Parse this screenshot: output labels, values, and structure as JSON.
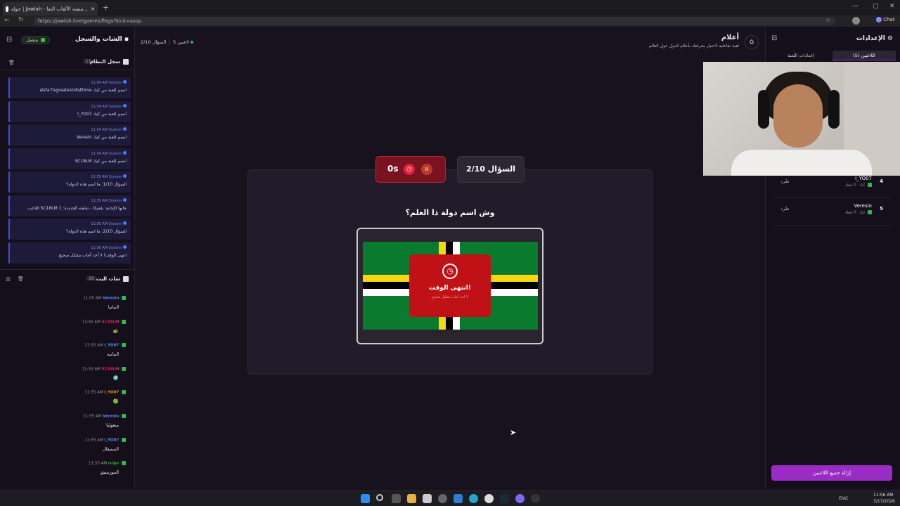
{
  "browser": {
    "tab_title": "جولة | Jawlah - منصة الألعاب التفا...",
    "url": "https://jawlah.live/games/flags?kick=asqu",
    "chat_label": "Chat"
  },
  "left_panel": {
    "title": "الشات والسجل",
    "status": "متصل",
    "system_log": {
      "title": "سجل النظام",
      "count": "11",
      "entries": [
        {
          "sender": "System",
          "time": "11:54 AM",
          "text": "alsfa7isgreatestofalltime انضم للعبة من كيك"
        },
        {
          "sender": "System",
          "time": "11:54 AM",
          "text": "I_YO07 انضم للعبة من كيك"
        },
        {
          "sender": "System",
          "time": "11:54 AM",
          "text": "Veresin انضم للعبة من كيك"
        },
        {
          "sender": "System",
          "time": "11:54 AM",
          "text": "SC18LM انضم للعبة من كيك"
        },
        {
          "sender": "System",
          "time": "11:55 AM",
          "text": "السؤال 1/10: ما اسم هذه الدولة؟"
        },
        {
          "sender": "System",
          "time": "11:55 AM",
          "text": "اللاعب SC18LM جابها الإجابة: بلجيكا - نقاطه الجديدة: 1"
        },
        {
          "sender": "System",
          "time": "11:55 AM",
          "text": "السؤال 2/10: ما اسم هذه الدولة؟"
        },
        {
          "sender": "System",
          "time": "11:56 AM",
          "text": "انتهى الوقت! لا أحد أجاب بشكل صحيح"
        }
      ]
    },
    "live_chat": {
      "title": "شات البث",
      "count": "16",
      "messages": [
        {
          "user": "Veresin",
          "time": "11:55 AM",
          "text": "المانيا",
          "color": "#5b8cff"
        },
        {
          "user": "SC18LM",
          "time": "11:55 AM",
          "text": "🐢",
          "color": "#e0245e"
        },
        {
          "user": "I_YO07",
          "time": "11:55 AM",
          "text": "المانيه",
          "color": "#5b8cff"
        },
        {
          "user": "SC18LM",
          "time": "11:55 AM",
          "text": "🌍",
          "color": "#e0245e"
        },
        {
          "user": "I_YO07",
          "time": "11:55 AM",
          "text": "🟢",
          "color": "#d9a400"
        },
        {
          "user": "Veresin",
          "time": "11:55 AM",
          "text": "منغوليا",
          "color": "#5b8cff"
        },
        {
          "user": "I_YO07",
          "time": "11:55 AM",
          "text": "السنيغال",
          "color": "#5b8cff"
        },
        {
          "user": "rclpv",
          "time": "11:55 AM",
          "text": "الموزمبيق",
          "color": "#2fb84e"
        }
      ]
    }
  },
  "header": {
    "players_count": "5 لاعبين",
    "question_progress": "السؤال 2/10",
    "game_title": "أعلام",
    "game_subtitle": "لعبة تفاعلية لاختبار معرفتك بأعلام الدول حول العالم"
  },
  "game": {
    "timer": "0s",
    "question_label": "السؤال 2/10",
    "question": "وش اسم دولة ذا العلم؟",
    "timeout_title": "انتهى الوقت!",
    "timeout_sub": "لا أحد أجاب بشكل صحيح"
  },
  "right_panel": {
    "title": "الإعدادات",
    "tabs": [
      "اللاعبين (5)",
      "إعدادات اللعبة"
    ],
    "players": [
      {
        "rank": "4",
        "name": "I_YO07",
        "meta": "كيك · 0 نقطة",
        "action": "طرد"
      },
      {
        "rank": "5",
        "name": "Veresin",
        "meta": "كيك · 0 نقطة",
        "action": "طرد"
      }
    ],
    "clear_button": "إزالة جميع اللاعبين"
  },
  "taskbar": {
    "lang": "ENG",
    "time": "11:56 AM",
    "date": "3/17/2026"
  }
}
